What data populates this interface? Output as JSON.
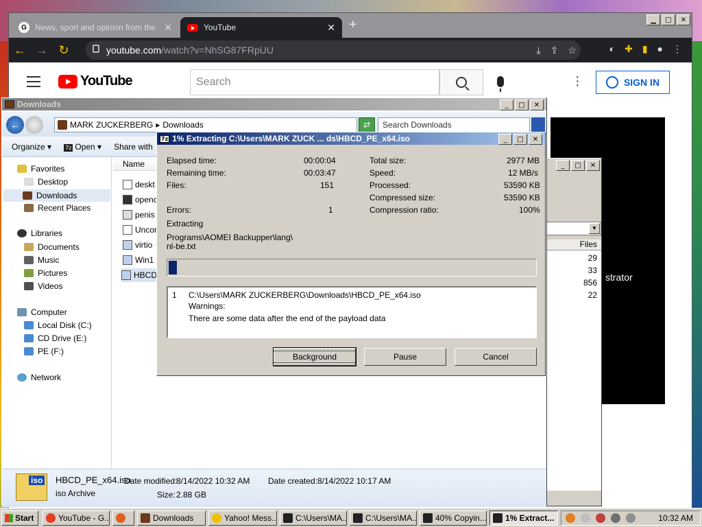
{
  "browser": {
    "tabs": [
      {
        "label": "News, sport and opinion from the G",
        "favicon": "guardian-icon"
      },
      {
        "label": "YouTube",
        "favicon": "youtube-icon"
      }
    ],
    "url_host": "youtube.com",
    "url_path": "/watch?v=NhSG87FRpUU",
    "youtube": {
      "logo_text": "YouTube",
      "search_placeholder": "Search",
      "sign_in_label": "SIGN IN",
      "overlay_text": "strator"
    }
  },
  "background_window": {
    "files_header": "Files",
    "counts": [
      "29",
      "33",
      "856",
      "22"
    ]
  },
  "explorer": {
    "title": "Downloads",
    "breadcrumb": [
      "MARK ZUCKERBERG",
      "Downloads"
    ],
    "search_placeholder": "Search Downloads",
    "commands": {
      "organize": "Organize",
      "open": "Open",
      "share": "Share with"
    },
    "nav": {
      "favorites": "Favorites",
      "desktop": "Desktop",
      "downloads": "Downloads",
      "recent": "Recent Places",
      "libraries": "Libraries",
      "documents": "Documents",
      "music": "Music",
      "pictures": "Pictures",
      "videos": "Videos",
      "computer": "Computer",
      "local_disk": "Local Disk (C:)",
      "cd_drive": "CD Drive (E:)",
      "pe": "PE (F:)",
      "network": "Network"
    },
    "column_name": "Name",
    "files": [
      "deskt",
      "openc",
      "penis",
      "Uncor",
      "virtio",
      "Win1",
      "HBCD"
    ],
    "details": {
      "filename": "HBCD_PE_x64.iso",
      "type": "iso Archive",
      "modified_label": "Date modified:",
      "modified": "8/14/2022 10:32 AM",
      "created_label": "Date created:",
      "created": "8/14/2022 10:17 AM",
      "size_label": "Size:",
      "size": "2.88 GB",
      "icon_text": "iso"
    }
  },
  "extract": {
    "title": "1% Extracting C:\\Users\\MARK ZUCK ... ds\\HBCD_PE_x64.iso",
    "progress": 0.02,
    "left": {
      "elapsed_label": "Elapsed time:",
      "elapsed": "00:00:04",
      "remaining_label": "Remaining time:",
      "remaining": "00:03:47",
      "files_label": "Files:",
      "files": "151",
      "errors_label": "Errors:",
      "errors": "1"
    },
    "right": {
      "total_label": "Total size:",
      "total": "2977 MB",
      "speed_label": "Speed:",
      "speed": "12 MB/s",
      "processed_label": "Processed:",
      "processed": "53590 KB",
      "compressed_label": "Compressed size:",
      "compressed": "53590 KB",
      "ratio_label": "Compression ratio:",
      "ratio": "100%"
    },
    "status": "Extracting",
    "current_file_1": "Programs\\AOMEI Backupper\\lang\\",
    "current_file_2": "nl-be.txt",
    "log": {
      "index": "1",
      "path": "C:\\Users\\MARK ZUCKERBERG\\Downloads\\HBCD_PE_x64.iso",
      "warnings": "Warnings:",
      "message": "There are some data after the end of the payload data"
    },
    "buttons": {
      "background": "Background",
      "pause": "Pause",
      "cancel": "Cancel"
    }
  },
  "taskbar": {
    "start": "Start",
    "tasks": [
      "YouTube - G...",
      "",
      "Downloads",
      "Yahoo! Mess...",
      "C:\\Users\\MA...",
      "C:\\Users\\MA...",
      "40% Copyin...",
      "1% Extract..."
    ],
    "clock": "10:32 AM"
  }
}
